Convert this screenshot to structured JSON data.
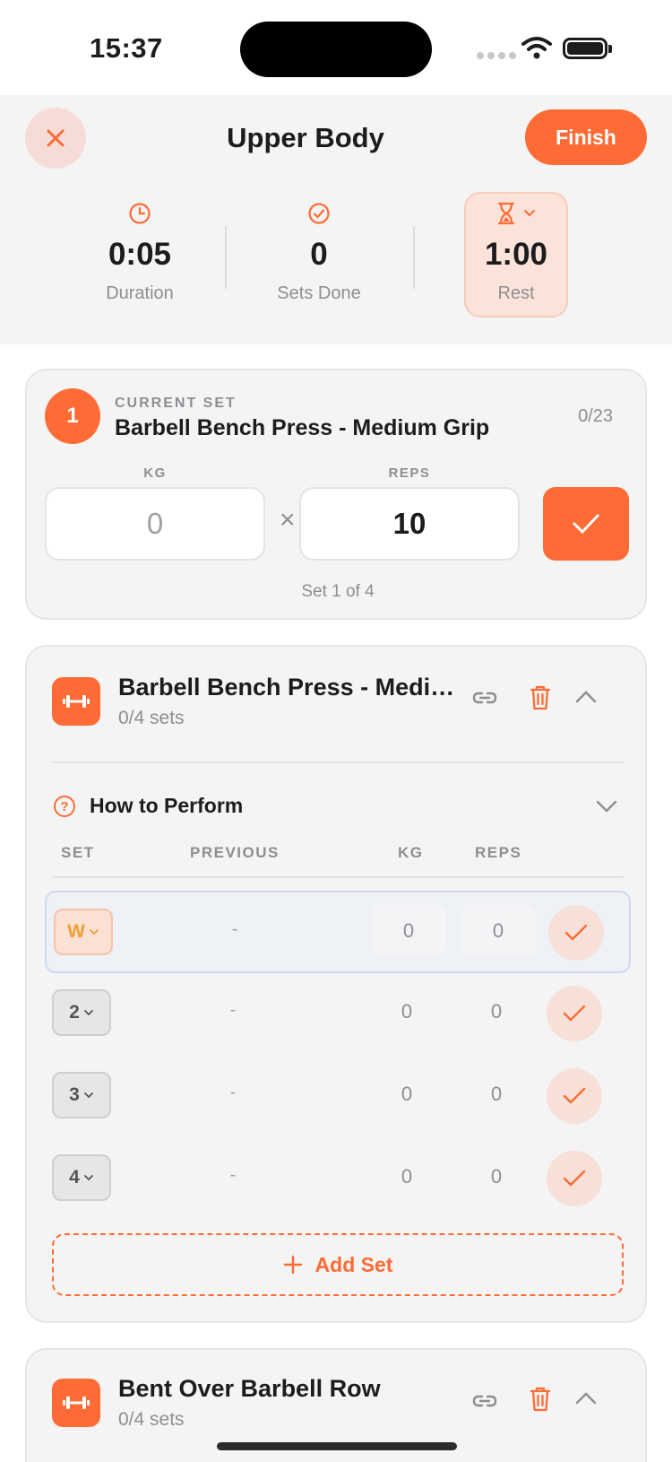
{
  "status": {
    "time": "15:37"
  },
  "header": {
    "title": "Upper Body",
    "finish_label": "Finish",
    "stats": [
      {
        "value": "0:05",
        "label": "Duration",
        "icon": "clock-icon"
      },
      {
        "value": "0",
        "label": "Sets Done",
        "icon": "check-circle-icon"
      },
      {
        "value": "1:00",
        "label": "Rest",
        "icon": "hourglass-icon"
      }
    ]
  },
  "current_set": {
    "label": "CURRENT SET",
    "number": "1",
    "exercise": "Barbell Bench Press - Medium Grip",
    "progress": "0/23",
    "kg_label": "KG",
    "reps_label": "REPS",
    "kg_value": "0",
    "reps_value": "10",
    "times": "×",
    "set_of": "Set 1 of 4"
  },
  "exercises": [
    {
      "name": "Barbell Bench Press - Medium Grip",
      "sets_label": "0/4 sets",
      "how_to": "How to Perform",
      "columns": {
        "set": "SET",
        "previous": "PREVIOUS",
        "kg": "KG",
        "reps": "REPS"
      },
      "rows": [
        {
          "set": "W",
          "previous": "-",
          "kg": "0",
          "reps": "0"
        },
        {
          "set": "2",
          "previous": "-",
          "kg": "0",
          "reps": "0"
        },
        {
          "set": "3",
          "previous": "-",
          "kg": "0",
          "reps": "0"
        },
        {
          "set": "4",
          "previous": "-",
          "kg": "0",
          "reps": "0"
        }
      ],
      "add_set_label": "Add Set"
    },
    {
      "name": "Bent Over Barbell Row",
      "sets_label": "0/4 sets"
    }
  ],
  "colors": {
    "accent": "#ff6b35",
    "accent_light": "#fbe3da",
    "warmup": "#f0a030"
  }
}
